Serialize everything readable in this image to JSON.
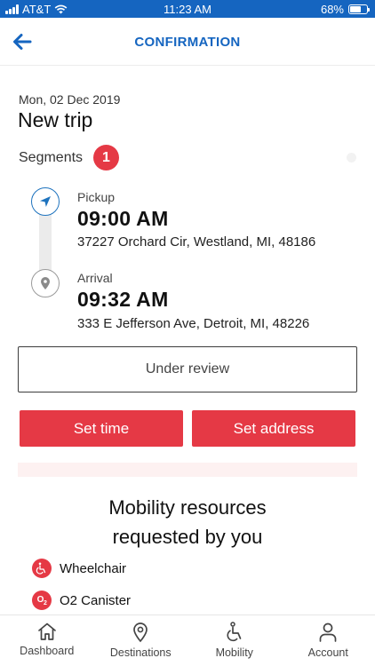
{
  "status_bar": {
    "carrier": "AT&T",
    "time": "11:23 AM",
    "battery": "68%",
    "battery_level": 0.68,
    "background_color": "#1565c0"
  },
  "header": {
    "title": "CONFIRMATION",
    "back_icon": "arrow-left-icon",
    "title_color": "#1565c0"
  },
  "trip": {
    "date": "Mon, 02 Dec 2019",
    "title": "New trip",
    "segments_label": "Segments",
    "segments_count": "1"
  },
  "pickup": {
    "label": "Pickup",
    "time": "09:00 AM",
    "address": "37227 Orchard Cir, Westland, MI, 48186",
    "icon": "navigation-arrow-icon"
  },
  "arrival": {
    "label": "Arrival",
    "time": "09:32 AM",
    "address": "333 E Jefferson Ave, Detroit, MI, 48226",
    "icon": "location-pin-icon"
  },
  "status": {
    "label": "Under review"
  },
  "actions": {
    "set_time": "Set time",
    "set_address": "Set address",
    "accent_color": "#e53945"
  },
  "mobility": {
    "title_line1": "Mobility resources",
    "title_line2": "requested by you",
    "resources": [
      {
        "label": "Wheelchair",
        "icon": "wheelchair-icon"
      },
      {
        "label": "O2 Canister",
        "icon": "o2-canister-icon"
      }
    ]
  },
  "tabs": [
    {
      "label": "Dashboard",
      "icon": "home-icon"
    },
    {
      "label": "Destinations",
      "icon": "map-pin-icon"
    },
    {
      "label": "Mobility",
      "icon": "wheelchair-icon"
    },
    {
      "label": "Account",
      "icon": "user-icon"
    }
  ]
}
